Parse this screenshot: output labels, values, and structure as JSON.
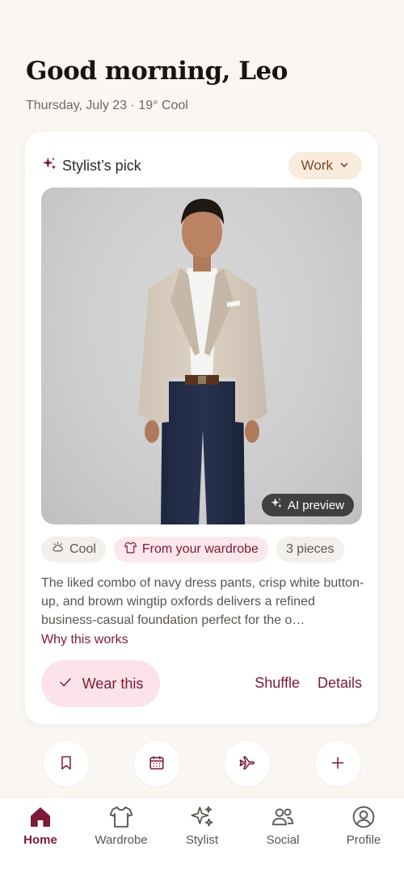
{
  "header": {
    "greeting": "Good morning, Leo",
    "subline": "Thursday, July 23 · 19° Cool"
  },
  "card": {
    "pick_label": "Stylist’s pick",
    "pick_icon": "sparkle-icon",
    "context": "Work",
    "ai_badge": "AI preview",
    "chips": {
      "weather": "Cool",
      "source": "From your wardrobe",
      "pieces": "3 pieces"
    },
    "description": "The liked combo of navy dress pants, crisp white button-up, and brown wingtip oxfords delivers a refined business-casual foundation perfect for the o…",
    "why_link": "Why this works",
    "wear_label": "Wear this",
    "shuffle_label": "Shuffle",
    "details_label": "Details"
  },
  "quick_actions": [
    {
      "icon": "bookmark-icon"
    },
    {
      "icon": "calendar-icon"
    },
    {
      "icon": "airplane-icon"
    },
    {
      "icon": "plus-icon"
    }
  ],
  "tabs": [
    {
      "label": "Home",
      "icon": "home-icon",
      "active": true
    },
    {
      "label": "Wardrobe",
      "icon": "shirt-icon",
      "active": false
    },
    {
      "label": "Stylist",
      "icon": "sparkle-icon",
      "active": false
    },
    {
      "label": "Social",
      "icon": "people-icon",
      "active": false
    },
    {
      "label": "Profile",
      "icon": "profile-icon",
      "active": false
    }
  ],
  "colors": {
    "accent": "#7d1a34",
    "background": "#faf7f2",
    "chip_rose": "#fbe8ec",
    "context_chip": "#f9ecdd"
  }
}
